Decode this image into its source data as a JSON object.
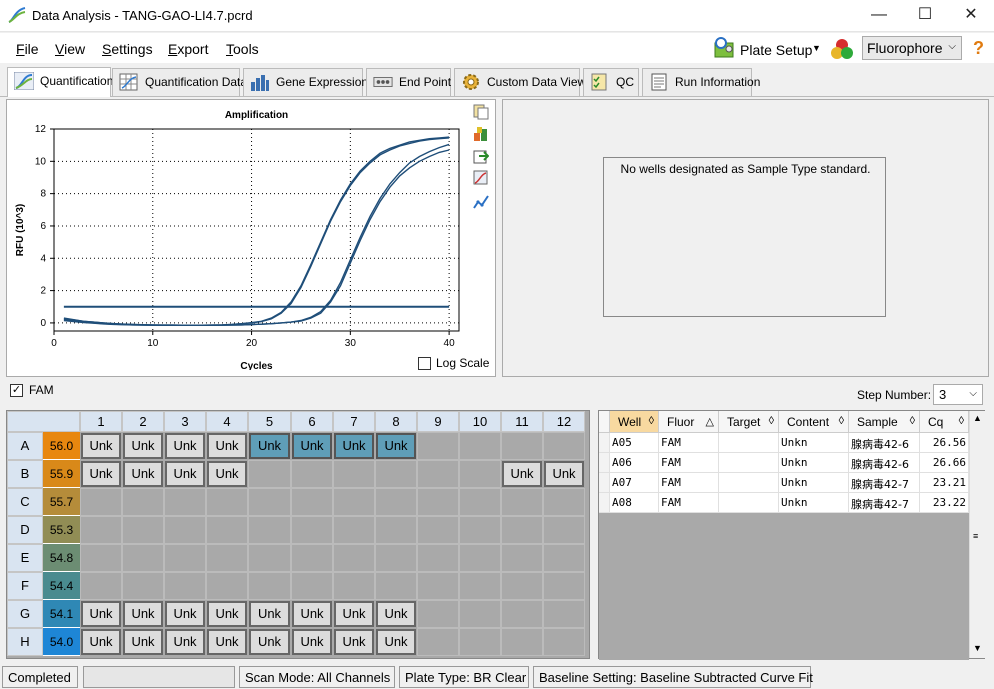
{
  "window": {
    "title": "Data Analysis - TANG-GAO-LI4.7.pcrd",
    "minimize": "—",
    "maximize": "☐",
    "close": "✕"
  },
  "menu": {
    "items": [
      "File",
      "View",
      "Settings",
      "Export",
      "Tools"
    ],
    "plate_setup_label": "Plate Setup",
    "fluorophore_value": "Fluorophore",
    "help_glyph": "?"
  },
  "tabs": [
    {
      "label": "Quantification",
      "icon": "amplification-curve-icon",
      "active": true
    },
    {
      "label": "Quantification Data",
      "icon": "data-table-icon",
      "active": false
    },
    {
      "label": "Gene Expression",
      "icon": "bar-chart-icon",
      "active": false
    },
    {
      "label": "End Point",
      "icon": "end-point-icon",
      "active": false
    },
    {
      "label": "Custom Data View",
      "icon": "gear-icon",
      "active": false
    },
    {
      "label": "QC",
      "icon": "checklist-icon",
      "active": false
    },
    {
      "label": "Run Information",
      "icon": "document-icon",
      "active": false
    }
  ],
  "chart_data": {
    "type": "line",
    "title": "Amplification",
    "xlabel": "Cycles",
    "ylabel": "RFU (10^3)",
    "xlim": [
      0,
      41
    ],
    "ylim": [
      -0.5,
      12
    ],
    "xticks": [
      0,
      10,
      20,
      30,
      40
    ],
    "yticks": [
      0,
      2,
      4,
      6,
      8,
      10,
      12
    ],
    "grid": true,
    "threshold": 1.0,
    "series_color": "#1f4e79",
    "x": [
      1,
      2,
      3,
      4,
      5,
      6,
      7,
      8,
      9,
      10,
      11,
      12,
      13,
      14,
      15,
      16,
      17,
      18,
      19,
      20,
      21,
      22,
      23,
      24,
      25,
      26,
      27,
      28,
      29,
      30,
      31,
      32,
      33,
      34,
      35,
      36,
      37,
      38,
      39,
      40
    ],
    "series": [
      {
        "values": [
          0.3,
          0.2,
          0.1,
          0.05,
          0.0,
          -0.05,
          -0.08,
          -0.1,
          -0.12,
          -0.13,
          -0.14,
          -0.14,
          -0.15,
          -0.15,
          -0.15,
          -0.14,
          -0.13,
          -0.1,
          -0.05,
          0.02,
          0.1,
          0.3,
          0.65,
          1.3,
          2.3,
          3.6,
          5.0,
          6.4,
          7.6,
          8.6,
          9.4,
          10.0,
          10.5,
          10.8,
          11.0,
          11.2,
          11.3,
          11.4,
          11.45,
          11.5
        ]
      },
      {
        "values": [
          0.25,
          0.18,
          0.1,
          0.05,
          0.0,
          -0.04,
          -0.07,
          -0.09,
          -0.11,
          -0.12,
          -0.13,
          -0.13,
          -0.14,
          -0.14,
          -0.14,
          -0.13,
          -0.12,
          -0.1,
          -0.05,
          0.0,
          0.08,
          0.25,
          0.6,
          1.2,
          2.2,
          3.5,
          4.9,
          6.3,
          7.5,
          8.5,
          9.3,
          9.9,
          10.4,
          10.7,
          10.95,
          11.1,
          11.25,
          11.35,
          11.4,
          11.45
        ]
      },
      {
        "values": [
          0.2,
          0.12,
          0.05,
          0.0,
          -0.05,
          -0.08,
          -0.1,
          -0.12,
          -0.13,
          -0.14,
          -0.15,
          -0.15,
          -0.15,
          -0.15,
          -0.15,
          -0.15,
          -0.14,
          -0.13,
          -0.12,
          -0.1,
          -0.08,
          -0.05,
          0.0,
          0.05,
          0.15,
          0.35,
          0.7,
          1.4,
          2.5,
          3.9,
          5.3,
          6.6,
          7.7,
          8.6,
          9.3,
          9.9,
          10.3,
          10.6,
          10.85,
          11.05
        ]
      },
      {
        "values": [
          0.15,
          0.08,
          0.02,
          -0.02,
          -0.06,
          -0.09,
          -0.11,
          -0.12,
          -0.13,
          -0.14,
          -0.15,
          -0.15,
          -0.15,
          -0.15,
          -0.15,
          -0.15,
          -0.14,
          -0.13,
          -0.12,
          -0.1,
          -0.08,
          -0.05,
          0.0,
          0.05,
          0.12,
          0.3,
          0.6,
          1.3,
          2.3,
          3.7,
          5.1,
          6.4,
          7.5,
          8.4,
          9.1,
          9.6,
          10.0,
          10.3,
          10.55,
          10.7
        ]
      }
    ]
  },
  "chart_tools": [
    "copy-icon",
    "palette-icon",
    "export-icon",
    "zoom-icon",
    "curve-options-icon"
  ],
  "log_scale_label": "Log Scale",
  "standard_curve": {
    "message": "No wells designated as Sample Type standard."
  },
  "fluor_bar": {
    "fam_label": "FAM",
    "step_label": "Step Number:",
    "step_value": "3"
  },
  "plate": {
    "columns": [
      "1",
      "2",
      "3",
      "4",
      "5",
      "6",
      "7",
      "8",
      "9",
      "10",
      "11",
      "12"
    ],
    "rows": [
      {
        "label": "A",
        "temp": "56.0",
        "temp_color": "#e8870f"
      },
      {
        "label": "B",
        "temp": "55.9",
        "temp_color": "#d98919"
      },
      {
        "label": "C",
        "temp": "55.7",
        "temp_color": "#b58c3a"
      },
      {
        "label": "D",
        "temp": "55.3",
        "temp_color": "#918d55"
      },
      {
        "label": "E",
        "temp": "54.8",
        "temp_color": "#6c8d73"
      },
      {
        "label": "F",
        "temp": "54.4",
        "temp_color": "#4a8b8f"
      },
      {
        "label": "G",
        "temp": "54.1",
        "temp_color": "#2f88b5"
      },
      {
        "label": "H",
        "temp": "54.0",
        "temp_color": "#1e86d6"
      }
    ],
    "wells": {
      "A": [
        "Unk",
        "Unk",
        "Unk",
        "Unk",
        "Unk*",
        "Unk*",
        "Unk*",
        "Unk*",
        "",
        "",
        "",
        ""
      ],
      "B": [
        "Unk",
        "Unk",
        "Unk",
        "Unk",
        "",
        "",
        "",
        "",
        "",
        "",
        "Unk",
        "Unk"
      ],
      "C": [
        "",
        "",
        "",
        "",
        "",
        "",
        "",
        "",
        "",
        "",
        "",
        ""
      ],
      "D": [
        "",
        "",
        "",
        "",
        "",
        "",
        "",
        "",
        "",
        "",
        "",
        ""
      ],
      "E": [
        "",
        "",
        "",
        "",
        "",
        "",
        "",
        "",
        "",
        "",
        "",
        ""
      ],
      "F": [
        "",
        "",
        "",
        "",
        "",
        "",
        "",
        "",
        "",
        "",
        "",
        ""
      ],
      "G": [
        "Unk",
        "Unk",
        "Unk",
        "Unk",
        "Unk",
        "Unk",
        "Unk",
        "Unk",
        "",
        "",
        "",
        ""
      ],
      "H": [
        "Unk",
        "Unk",
        "Unk",
        "Unk",
        "Unk",
        "Unk",
        "Unk",
        "Unk",
        "",
        "",
        "",
        ""
      ]
    }
  },
  "table": {
    "headers": [
      "Well",
      "Fluor",
      "Target",
      "Content",
      "Sample",
      "Cq"
    ],
    "sort_glyphs": [
      "◊",
      "△",
      "◊",
      "◊",
      "◊",
      "◊"
    ],
    "rows": [
      [
        "A05",
        "FAM",
        "",
        "Unkn",
        "腺病毒42-6",
        "26.56"
      ],
      [
        "A06",
        "FAM",
        "",
        "Unkn",
        "腺病毒42-6",
        "26.66"
      ],
      [
        "A07",
        "FAM",
        "",
        "Unkn",
        "腺病毒42-7",
        "23.21"
      ],
      [
        "A08",
        "FAM",
        "",
        "Unkn",
        "腺病毒42-7",
        "23.22"
      ]
    ]
  },
  "status": {
    "state": "Completed",
    "scan_mode": "Scan Mode: All Channels",
    "plate_type": "Plate Type: BR Clear",
    "baseline": "Baseline Setting: Baseline Subtracted Curve Fit"
  }
}
